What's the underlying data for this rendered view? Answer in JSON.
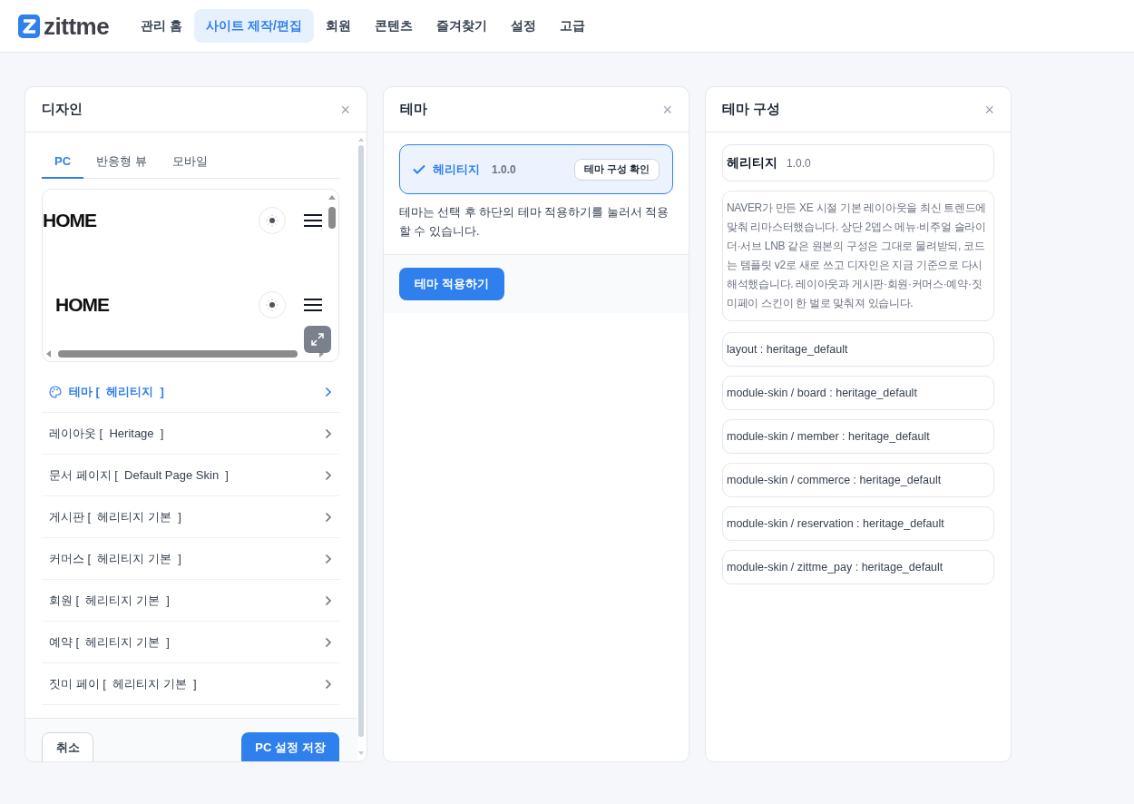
{
  "nav": {
    "logo": "zittme",
    "items": [
      {
        "label": "관리 홈",
        "selected": false
      },
      {
        "label": "사이트 제작/편집",
        "selected": true
      },
      {
        "label": "회원",
        "selected": false
      },
      {
        "label": "콘텐츠",
        "selected": false
      },
      {
        "label": "즐겨찾기",
        "selected": false
      },
      {
        "label": "설정",
        "selected": false
      },
      {
        "label": "고급",
        "selected": false
      }
    ]
  },
  "design_panel": {
    "title": "디자인",
    "close": "×",
    "tabs": [
      {
        "label": "PC",
        "selected": true
      },
      {
        "label": "반응형 뷰",
        "selected": false
      },
      {
        "label": "모바일",
        "selected": false
      }
    ],
    "preview": {
      "rows": [
        {
          "heading": "HOME"
        },
        {
          "heading": "HOME"
        }
      ]
    },
    "items": [
      {
        "text": "테마 [  헤리티지  ]",
        "selected": true
      },
      {
        "text": "레이아웃 [  Heritage  ]",
        "selected": false
      },
      {
        "text": "문서 페이지 [  Default Page Skin  ]",
        "selected": false
      },
      {
        "text": "게시판 [  헤리티지 기본  ]",
        "selected": false
      },
      {
        "text": "커머스 [  헤리티지 기본  ]",
        "selected": false
      },
      {
        "text": "회원 [  헤리티지 기본  ]",
        "selected": false
      },
      {
        "text": "예약 [  헤리티지 기본  ]",
        "selected": false
      },
      {
        "text": "짓미 페이 [  헤리티지 기본  ]",
        "selected": false
      }
    ],
    "cancel": "취소",
    "save": "PC 설정 저장"
  },
  "theme_panel": {
    "title": "테마",
    "close": "×",
    "themes": [
      {
        "name": "헤리티지",
        "version": "1.0.0",
        "action": "테마 구성 확인",
        "selected": true
      }
    ],
    "note": "테마는 선택 후 하단의 테마 적용하기를 눌러서 적용할 수 있습니다.",
    "apply": "테마 적용하기"
  },
  "config_panel": {
    "title": "테마 구성",
    "close": "×",
    "name": "헤리티지",
    "version": "1.0.0",
    "description": "NAVER가 만든 XE 시절 기본 레이아웃을 최신 트렌드에 맞춰 리마스터했습니다. 상단 2뎁스 메뉴·비주얼 슬라이더·서브 LNB 같은 원본의 구성은 그대로 물려받되, 코드는 템플릿 v2로 새로 쓰고 디자인은 지금 기준으로 다시 해석했습니다. 레이아웃과 게시판·회원·커머스·예약·짓미페이 스킨이 한 벌로 맞춰져 있습니다.",
    "entries": [
      "layout : heritage_default",
      "module-skin / board : heritage_default",
      "module-skin / member : heritage_default",
      "module-skin / commerce : heritage_default",
      "module-skin / reservation : heritage_default",
      "module-skin / zittme_pay : heritage_default"
    ]
  }
}
